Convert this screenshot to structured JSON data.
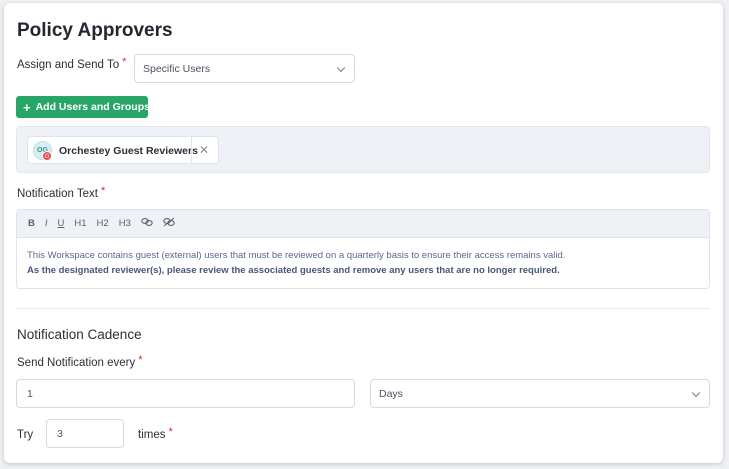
{
  "page": {
    "title": "Policy Approvers"
  },
  "assign": {
    "label": "Assign and Send To",
    "required_mark": "*",
    "selected": "Specific Users",
    "add_button": "Add Users and Groups"
  },
  "groups": [
    {
      "name": "Orchestey Guest Reviewers",
      "avatar_initials": "OG",
      "badge": "G",
      "remove_icon": "close-icon"
    }
  ],
  "notification": {
    "label": "Notification Text",
    "required_mark": "*",
    "toolbar": [
      "B",
      "I",
      "U",
      "H1",
      "H2",
      "H3",
      "link-icon",
      "unlink-icon"
    ],
    "body_line1": "This Workspace contains guest (external) users that must be reviewed on a quarterly basis to ensure their access remains valid.",
    "body_line2": "As the designated reviewer(s), please review the associated guests and remove any users that are no longer required."
  },
  "cadence": {
    "section_title": "Notification Cadence",
    "every_label": "Send Notification every",
    "required_mark": "*",
    "every_value": "1",
    "unit_selected": "Days",
    "try_label": "Try",
    "try_value": "3",
    "times_label": "times"
  },
  "colors": {
    "accent_green": "#28a667",
    "required_red": "#e02424",
    "panel_bg": "#eef1f6"
  }
}
